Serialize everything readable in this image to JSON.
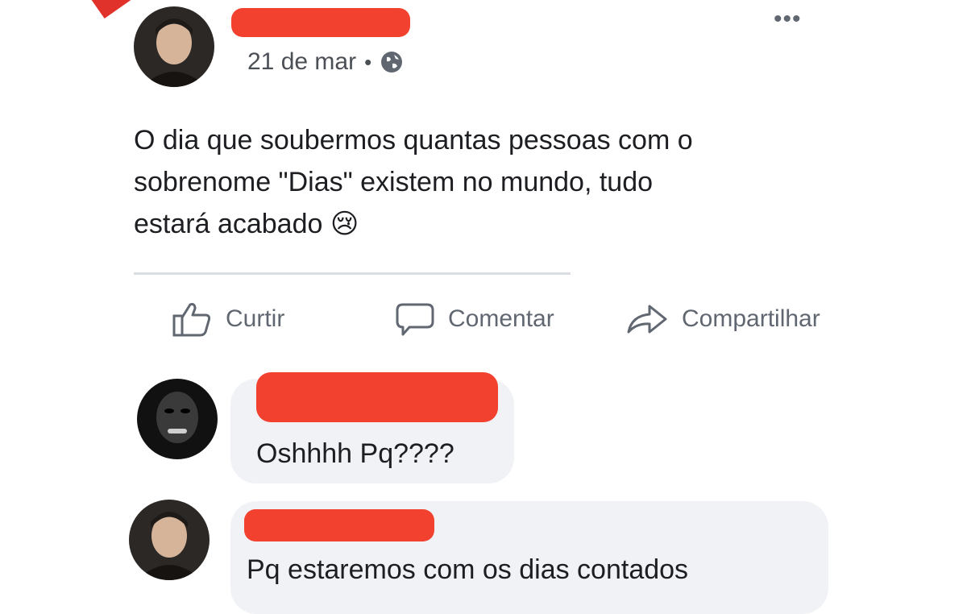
{
  "post": {
    "date": "21 de mar",
    "separator": "•",
    "text": "O dia que soubermos quantas pessoas com o\nsobrenome \"Dias\" existem no mundo, tudo\nestará acabado 😢",
    "icons": {
      "privacy": "globe-icon",
      "more": "more-options-icon"
    }
  },
  "actions": {
    "like": "Curtir",
    "comment": "Comentar",
    "share": "Compartilhar"
  },
  "comments": [
    {
      "text": "Oshhhh Pq????"
    },
    {
      "text": "Pq estaremos com os dias contados"
    }
  ],
  "colors": {
    "redaction": "#f2412f",
    "bubble": "#f0f2f5",
    "secondary_text": "#606770"
  }
}
